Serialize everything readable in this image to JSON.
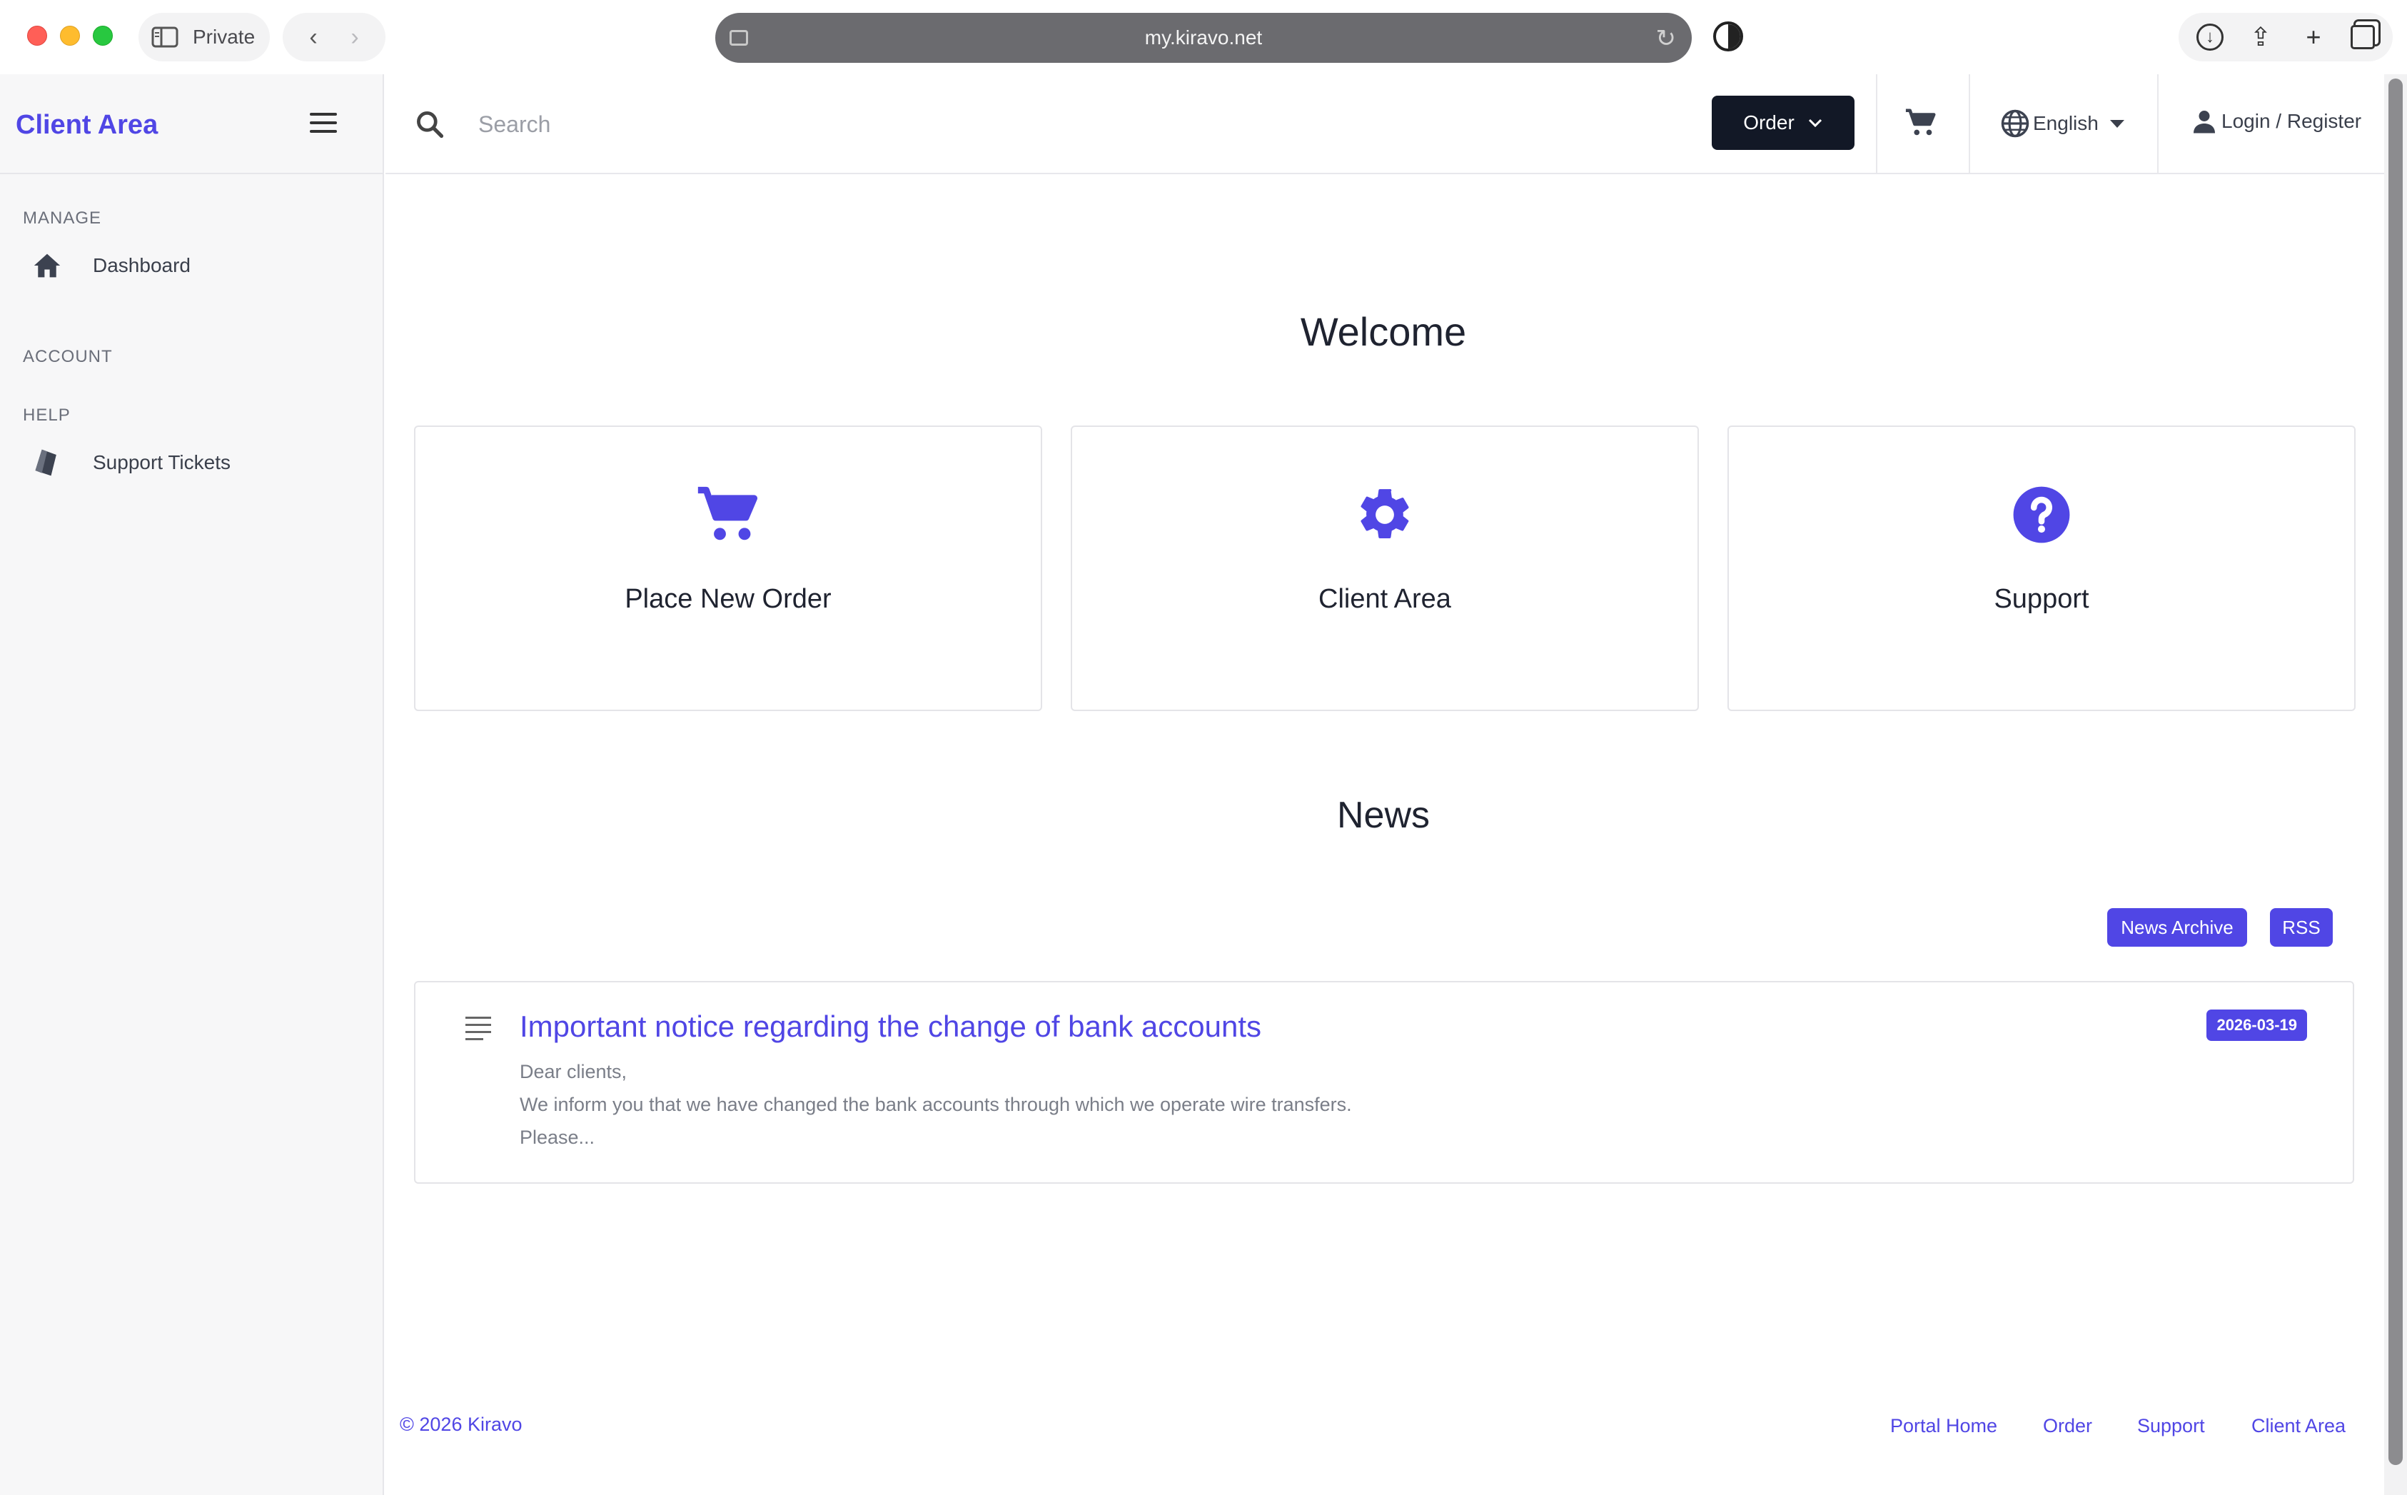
{
  "browser": {
    "private_label": "Private",
    "url": "my.kiravo.net"
  },
  "sidebar": {
    "brand": "Client Area",
    "sections": [
      {
        "label": "MANAGE",
        "items": [
          {
            "label": "Dashboard",
            "icon": "home-icon"
          }
        ]
      },
      {
        "label": "ACCOUNT",
        "items": []
      },
      {
        "label": "HELP",
        "items": [
          {
            "label": "Support Tickets",
            "icon": "ticket-icon"
          }
        ]
      }
    ]
  },
  "topbar": {
    "search_placeholder": "Search",
    "order_label": "Order",
    "language": "English",
    "login_label": "Login / Register"
  },
  "main": {
    "welcome": "Welcome",
    "cards": [
      {
        "title": "Place New Order",
        "icon": "cart-icon"
      },
      {
        "title": "Client Area",
        "icon": "gear-icon"
      },
      {
        "title": "Support",
        "icon": "question-icon"
      }
    ],
    "news_heading": "News",
    "news_archive_label": "News Archive",
    "rss_label": "RSS",
    "news_items": [
      {
        "title": "Important notice regarding the change of bank accounts",
        "date": "2026-03-19",
        "lines": [
          "Dear clients,",
          "We inform you that we have changed the bank accounts through which we operate wire transfers.",
          "Please..."
        ]
      }
    ]
  },
  "footer": {
    "copyright": "© 2026 Kiravo",
    "links": [
      "Portal Home",
      "Order",
      "Support",
      "Client Area"
    ]
  },
  "colors": {
    "accent": "#5046e5",
    "dark_button": "#121826",
    "sidebar_bg": "#f7f7f8"
  }
}
